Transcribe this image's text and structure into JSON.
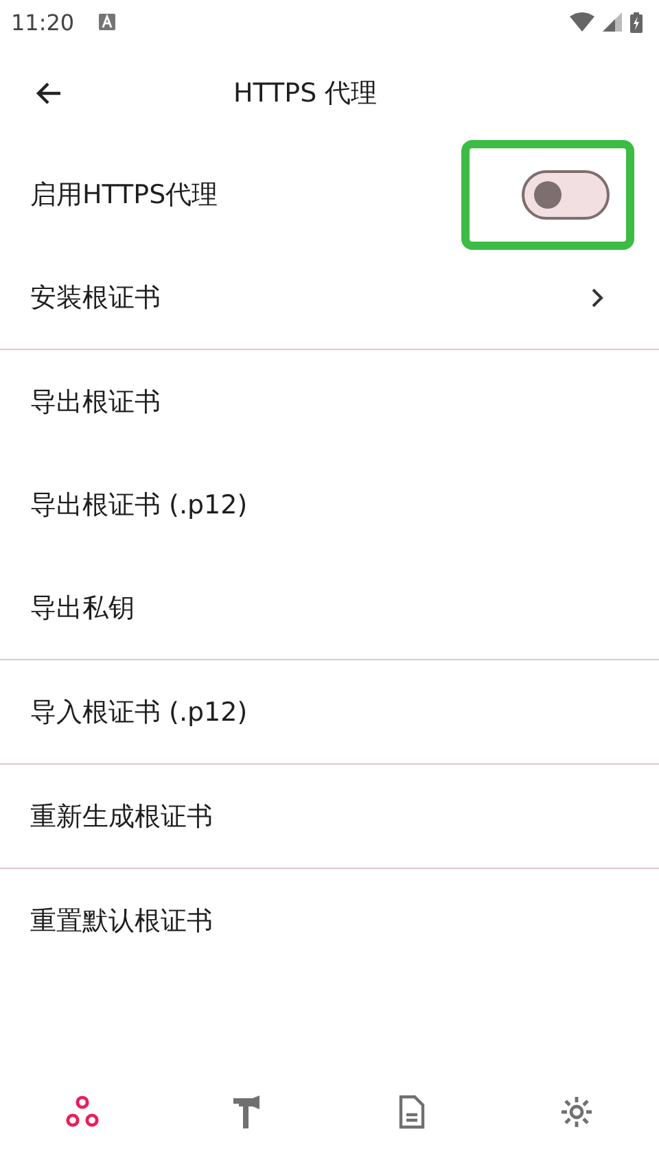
{
  "status_bar": {
    "time": "11:20"
  },
  "header": {
    "title": "HTTPS 代理"
  },
  "sections": [
    [
      {
        "kind": "switch",
        "label": "启用HTTPS代理",
        "on": false,
        "highlighted": true
      },
      {
        "kind": "link",
        "label": "安装根证书"
      }
    ],
    [
      {
        "kind": "plain",
        "label": "导出根证书"
      },
      {
        "kind": "plain",
        "label": "导出根证书 (.p12)"
      },
      {
        "kind": "plain",
        "label": "导出私钥"
      }
    ],
    [
      {
        "kind": "plain",
        "label": "导入根证书 (.p12)"
      }
    ],
    [
      {
        "kind": "plain",
        "label": "重新生成根证书"
      }
    ],
    [
      {
        "kind": "plain",
        "label": "重置默认根证书"
      }
    ]
  ],
  "bottom_nav": [
    {
      "kind": "network",
      "selected": true
    },
    {
      "kind": "tools",
      "selected": false
    },
    {
      "kind": "logs",
      "selected": false
    },
    {
      "kind": "settings",
      "selected": false
    }
  ]
}
